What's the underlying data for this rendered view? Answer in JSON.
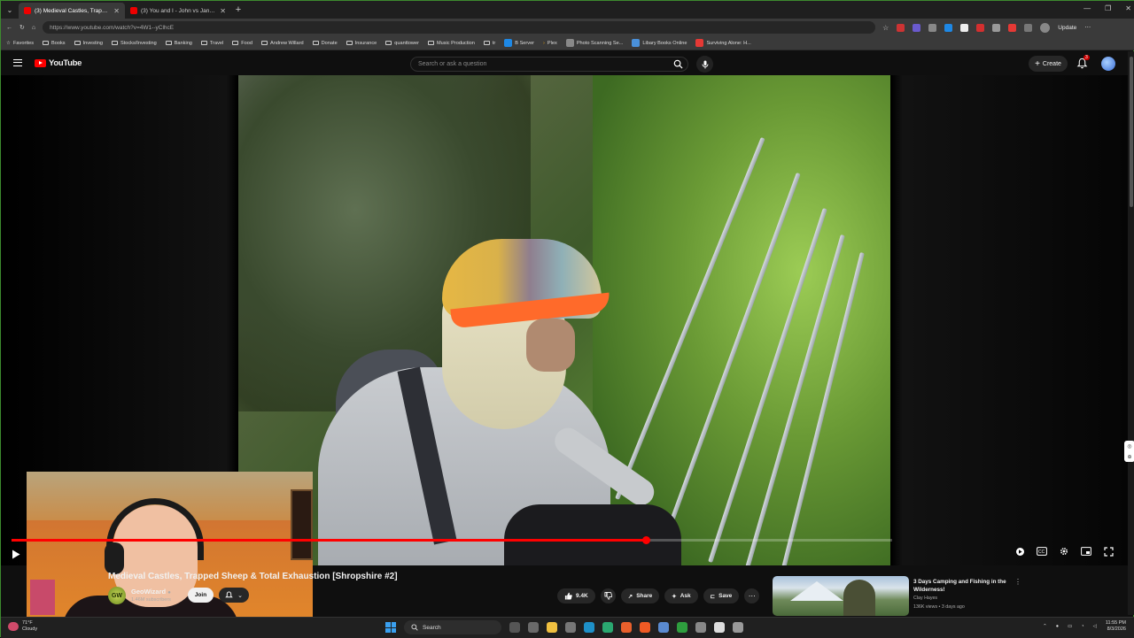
{
  "browser": {
    "tabs": [
      {
        "label": "(3) Medieval Castles, Trapped",
        "active": true
      },
      {
        "label": "(3) You and I - John vs Jane LMS |",
        "active": false
      }
    ],
    "url": "https://www.youtube.com/watch?v=4W1--yClhcE",
    "update_label": "Update",
    "bookmarks": [
      "Favorites",
      "Books",
      "Investing",
      "Stocks/Investing",
      "Banking",
      "Travel",
      "Food",
      "Andrew Willard",
      "Donate",
      "Insurance",
      "quanttower",
      "Music Production",
      "tr",
      "B Server",
      "Plex",
      "Photo Scanning Se...",
      "Libary Books Online",
      "Surviving Alone: H..."
    ]
  },
  "youtube": {
    "logo_text": "YouTube",
    "search_placeholder": "Search or ask a question",
    "create_label": "Create",
    "notification_count": "3"
  },
  "video": {
    "title": "Medieval Castles, Trapped Sheep & Total Exhaustion [Shropshire #2]",
    "channel": "GeoWizard",
    "channel_avatar_text": "GW",
    "subscribers": "1.46M subscribers",
    "join_label": "Join",
    "likes": "9.4K",
    "share_label": "Share",
    "ask_label": "Ask",
    "save_label": "Save",
    "progress_fraction": 0.72
  },
  "recommendation": {
    "title": "3 Days Camping and Fishing in the Wilderness!",
    "channel": "Clay Hayes",
    "meta": "136K views • 3 days ago"
  },
  "taskbar": {
    "weather_temp": "71°F",
    "weather_desc": "Cloudy",
    "search_label": "Search",
    "time": "11:55 PM",
    "date": "8/3/2026"
  },
  "colors": {
    "accent": "#ff0000",
    "background": "#0f0f0f",
    "window_border": "#3c8a2e"
  }
}
